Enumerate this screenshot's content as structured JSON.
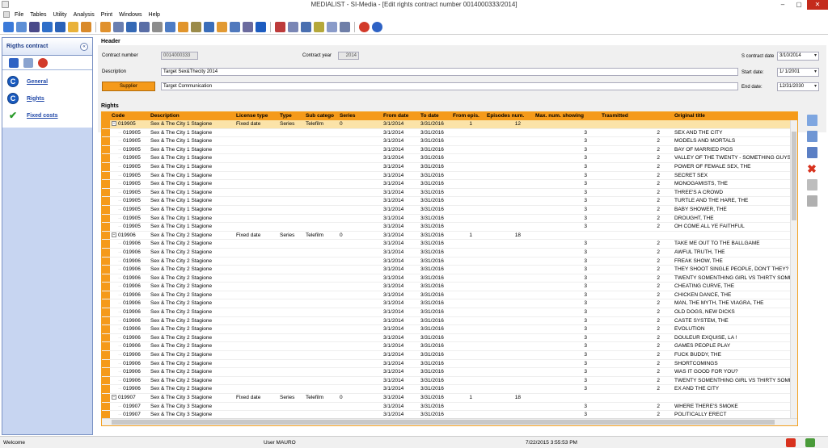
{
  "window": {
    "title": "MEDIALIST - SI-Media  - [Edit rights contract number 0014000333/2014]"
  },
  "menu": [
    "File",
    "Tables",
    "Utility",
    "Analysis",
    "Print",
    "Windows",
    "Help"
  ],
  "sidebar": {
    "title": "Rigths contract",
    "items": [
      {
        "label": "General"
      },
      {
        "label": "Rights"
      },
      {
        "label": "Fixed costs"
      }
    ]
  },
  "header": {
    "title": "Header",
    "contract_number_label": "Contract number",
    "contract_number": "0014000333",
    "contract_year_label": "Contract year",
    "contract_year": "2014",
    "s_contract_date_label": "S contract date",
    "s_contract_date": "3/10/2014",
    "description_label": "Description",
    "description": "Target Sex&Thecity 2014",
    "start_date_label": "Start date:",
    "start_date": "1/ 1/2001",
    "supplier_label": "Supplier",
    "supplier": "Target Communication",
    "end_date_label": "End date:",
    "end_date": "12/31/2030"
  },
  "rights": {
    "title": "Rights",
    "columns": [
      "Code",
      "Description",
      "License type",
      "Type",
      "Sub catego",
      "Series",
      "From date",
      "To date",
      "From epis.",
      "Episodes num.",
      "Max. num. showing",
      "Trasmitted",
      "Original title"
    ],
    "rows": [
      {
        "kind": "parent",
        "sel": true,
        "code": "019905",
        "desc": "Sex & The City 1 Stagione",
        "license": "Fixed date",
        "type": "Series",
        "sub": "Telefilm",
        "series": "0",
        "from": "3/1/2014",
        "to": "3/31/2016",
        "fep": "1",
        "epn": "12",
        "max": "",
        "tras": "",
        "title": ""
      },
      {
        "kind": "child",
        "code": "019905",
        "desc": "Sex & The City 1 Stagione",
        "from": "3/1/2014",
        "to": "3/31/2016",
        "max": "3",
        "tras": "2",
        "title": "SEX AND THE CITY"
      },
      {
        "kind": "child",
        "code": "019905",
        "desc": "Sex & The City 1 Stagione",
        "from": "3/1/2014",
        "to": "3/31/2016",
        "max": "3",
        "tras": "2",
        "title": "MODELS AND MORTALS"
      },
      {
        "kind": "child",
        "code": "019905",
        "desc": "Sex & The City 1 Stagione",
        "from": "3/1/2014",
        "to": "3/31/2016",
        "max": "3",
        "tras": "2",
        "title": "BAY OF MARRIED PIGS"
      },
      {
        "kind": "child",
        "code": "019905",
        "desc": "Sex & The City 1 Stagione",
        "from": "3/1/2014",
        "to": "3/31/2016",
        "max": "3",
        "tras": "2",
        "title": "VALLEY OF THE TWENTY - SOMETHING GUYS"
      },
      {
        "kind": "child",
        "code": "019905",
        "desc": "Sex & The City 1 Stagione",
        "from": "3/1/2014",
        "to": "3/31/2016",
        "max": "3",
        "tras": "2",
        "title": "POWER OF FEMALE SEX, THE"
      },
      {
        "kind": "child",
        "code": "019905",
        "desc": "Sex & The City 1 Stagione",
        "from": "3/1/2014",
        "to": "3/31/2016",
        "max": "3",
        "tras": "2",
        "title": "SECRET SEX"
      },
      {
        "kind": "child",
        "code": "019905",
        "desc": "Sex & The City 1 Stagione",
        "from": "3/1/2014",
        "to": "3/31/2016",
        "max": "3",
        "tras": "2",
        "title": "MONOGAMISTS, THE"
      },
      {
        "kind": "child",
        "code": "019905",
        "desc": "Sex & The City 1 Stagione",
        "from": "3/1/2014",
        "to": "3/31/2016",
        "max": "3",
        "tras": "2",
        "title": "THREE'S A CROWD"
      },
      {
        "kind": "child",
        "code": "019905",
        "desc": "Sex & The City 1 Stagione",
        "from": "3/1/2014",
        "to": "3/31/2016",
        "max": "3",
        "tras": "2",
        "title": "TURTLE AND THE HARE, THE"
      },
      {
        "kind": "child",
        "code": "019905",
        "desc": "Sex & The City 1 Stagione",
        "from": "3/1/2014",
        "to": "3/31/2016",
        "max": "3",
        "tras": "2",
        "title": "BABY SHOWER, THE"
      },
      {
        "kind": "child",
        "code": "019905",
        "desc": "Sex & The City 1 Stagione",
        "from": "3/1/2014",
        "to": "3/31/2016",
        "max": "3",
        "tras": "2",
        "title": "DROUGHT, THE"
      },
      {
        "kind": "child",
        "code": "019905",
        "desc": "Sex & The City 1 Stagione",
        "from": "3/1/2014",
        "to": "3/31/2016",
        "max": "3",
        "tras": "2",
        "title": "OH COME ALL YE FAITHFUL"
      },
      {
        "kind": "parent",
        "sel": false,
        "code": "019906",
        "desc": "Sex & The City 2 Stagione",
        "license": "Fixed date",
        "type": "Series",
        "sub": "Telefilm",
        "series": "0",
        "from": "3/1/2014",
        "to": "3/31/2016",
        "fep": "1",
        "epn": "18",
        "max": "",
        "tras": "",
        "title": ""
      },
      {
        "kind": "child",
        "code": "019906",
        "desc": "Sex & The City 2 Stagione",
        "from": "3/1/2014",
        "to": "3/31/2016",
        "max": "3",
        "tras": "2",
        "title": "TAKE ME OUT TO THE BALLGAME"
      },
      {
        "kind": "child",
        "code": "019906",
        "desc": "Sex & The City 2 Stagione",
        "from": "3/1/2014",
        "to": "3/31/2016",
        "max": "3",
        "tras": "2",
        "title": "AWFUL TRUTH, THE"
      },
      {
        "kind": "child",
        "code": "019906",
        "desc": "Sex & The City 2 Stagione",
        "from": "3/1/2014",
        "to": "3/31/2016",
        "max": "3",
        "tras": "2",
        "title": "FREAK SHOW, THE"
      },
      {
        "kind": "child",
        "code": "019906",
        "desc": "Sex & The City 2 Stagione",
        "from": "3/1/2014",
        "to": "3/31/2016",
        "max": "3",
        "tras": "2",
        "title": "THEY SHOOT SINGLE PEOPLE, DON'T THEY?"
      },
      {
        "kind": "child",
        "code": "019906",
        "desc": "Sex & The City 2 Stagione",
        "from": "3/1/2014",
        "to": "3/31/2016",
        "max": "3",
        "tras": "2",
        "title": "TWENTY SOMENTHING GIRL VS THIRTY SOME"
      },
      {
        "kind": "child",
        "code": "019906",
        "desc": "Sex & The City 2 Stagione",
        "from": "3/1/2014",
        "to": "3/31/2016",
        "max": "3",
        "tras": "2",
        "title": "CHEATING CURVE, THE"
      },
      {
        "kind": "child",
        "code": "019906",
        "desc": "Sex & The City 2 Stagione",
        "from": "3/1/2014",
        "to": "3/31/2016",
        "max": "3",
        "tras": "2",
        "title": "CHICKEN DANCE, THE"
      },
      {
        "kind": "child",
        "code": "019906",
        "desc": "Sex & The City 2 Stagione",
        "from": "3/1/2014",
        "to": "3/31/2016",
        "max": "3",
        "tras": "2",
        "title": "MAN, THE MYTH, THE VIAGRA, THE"
      },
      {
        "kind": "child",
        "code": "019906",
        "desc": "Sex & The City 2 Stagione",
        "from": "3/1/2014",
        "to": "3/31/2016",
        "max": "3",
        "tras": "2",
        "title": "OLD DOGS, NEW DICKS"
      },
      {
        "kind": "child",
        "code": "019906",
        "desc": "Sex & The City 2 Stagione",
        "from": "3/1/2014",
        "to": "3/31/2016",
        "max": "3",
        "tras": "2",
        "title": "CASTE SYSTEM, THE"
      },
      {
        "kind": "child",
        "code": "019906",
        "desc": "Sex & The City 2 Stagione",
        "from": "3/1/2014",
        "to": "3/31/2016",
        "max": "3",
        "tras": "2",
        "title": "EVOLUTION"
      },
      {
        "kind": "child",
        "code": "019906",
        "desc": "Sex & The City 2 Stagione",
        "from": "3/1/2014",
        "to": "3/31/2016",
        "max": "3",
        "tras": "2",
        "title": "DOULEUR EXQUISE, LA !"
      },
      {
        "kind": "child",
        "code": "019906",
        "desc": "Sex & The City 2 Stagione",
        "from": "3/1/2014",
        "to": "3/31/2016",
        "max": "3",
        "tras": "2",
        "title": "GAMES PEOPLE PLAY"
      },
      {
        "kind": "child",
        "code": "019906",
        "desc": "Sex & The City 2 Stagione",
        "from": "3/1/2014",
        "to": "3/31/2016",
        "max": "3",
        "tras": "2",
        "title": "FUCK BUDDY, THE"
      },
      {
        "kind": "child",
        "code": "019906",
        "desc": "Sex & The City 2 Stagione",
        "from": "3/1/2014",
        "to": "3/31/2016",
        "max": "3",
        "tras": "2",
        "title": "SHORTCOMINGS"
      },
      {
        "kind": "child",
        "code": "019906",
        "desc": "Sex & The City 2 Stagione",
        "from": "3/1/2014",
        "to": "3/31/2016",
        "max": "3",
        "tras": "2",
        "title": "WAS IT GOOD FOR YOU?"
      },
      {
        "kind": "child",
        "code": "019906",
        "desc": "Sex & The City 2 Stagione",
        "from": "3/1/2014",
        "to": "3/31/2016",
        "max": "3",
        "tras": "2",
        "title": "TWENTY SOMENTHING GIRL VS THIRTY SOME"
      },
      {
        "kind": "child",
        "code": "019906",
        "desc": "Sex & The City 2 Stagione",
        "from": "3/1/2014",
        "to": "3/31/2016",
        "max": "3",
        "tras": "2",
        "title": "EX AND THE CITY"
      },
      {
        "kind": "parent",
        "sel": false,
        "code": "019907",
        "desc": "Sex & The City 3 Stagione",
        "license": "Fixed date",
        "type": "Series",
        "sub": "Telefilm",
        "series": "0",
        "from": "3/1/2014",
        "to": "3/31/2016",
        "fep": "1",
        "epn": "18",
        "max": "",
        "tras": "",
        "title": ""
      },
      {
        "kind": "child",
        "code": "019907",
        "desc": "Sex & The City 3 Stagione",
        "from": "3/1/2014",
        "to": "3/31/2016",
        "max": "3",
        "tras": "2",
        "title": "WHERE THERE'S SMOKE"
      },
      {
        "kind": "child",
        "code": "019907",
        "desc": "Sex & The City 3 Stagione",
        "from": "3/1/2014",
        "to": "3/31/2016",
        "max": "3",
        "tras": "2",
        "title": "POLITICALLY ERECT"
      }
    ]
  },
  "status": {
    "left": "Welcome",
    "user": "User MAURO",
    "datetime": "7/22/2015 3:55:53 PM"
  },
  "colors": {
    "accent_orange": "#f59a1a",
    "sidebar_blue": "#c7d5f1",
    "link_blue": "#2048a8"
  }
}
